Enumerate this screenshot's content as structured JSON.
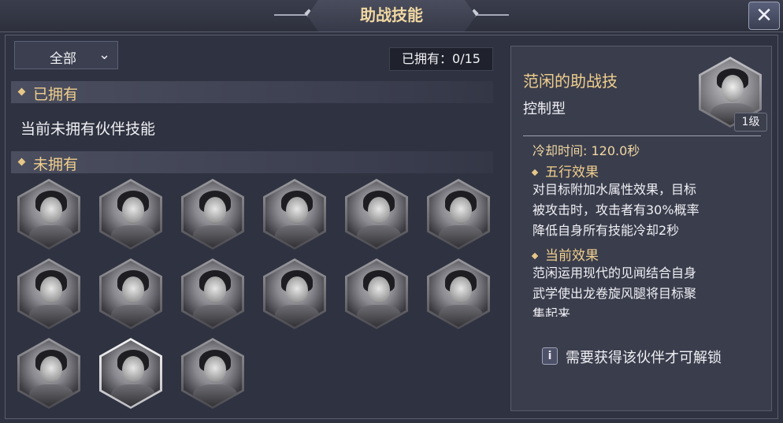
{
  "header": {
    "title": "助战技能",
    "close_icon": "close-x-icon"
  },
  "filter": {
    "selected": "全部",
    "chevron": "chevron-down-icon"
  },
  "owned_count": "已拥有：0/15",
  "sections": {
    "owned": {
      "label": "已拥有",
      "empty_text": "当前未拥有伙伴技能"
    },
    "not_owned": {
      "label": "未拥有"
    }
  },
  "partners": [
    {
      "icon": "hooded-elder-portrait",
      "selected": false
    },
    {
      "icon": "young-man-headband-portrait",
      "selected": false
    },
    {
      "icon": "long-hair-swordsman-portrait",
      "selected": false
    },
    {
      "icon": "white-haired-elder-portrait",
      "selected": false
    },
    {
      "icon": "blindfolded-man-portrait",
      "selected": false
    },
    {
      "icon": "young-man-topknot-portrait",
      "selected": false
    },
    {
      "icon": "long-hair-man-portrait",
      "selected": false
    },
    {
      "icon": "bearded-man-headband-portrait",
      "selected": false
    },
    {
      "icon": "masked-man-portrait",
      "selected": false
    },
    {
      "icon": "armored-man-portrait",
      "selected": false
    },
    {
      "icon": "youth-crown-portrait",
      "selected": false
    },
    {
      "icon": "young-woman-portrait",
      "selected": false
    },
    {
      "icon": "official-hat-man-portrait",
      "selected": false
    },
    {
      "icon": "fan-xian-portrait",
      "selected": true
    },
    {
      "icon": "lady-hairpin-portrait",
      "selected": false
    }
  ],
  "detail": {
    "skill_name": "范闲的助战技",
    "skill_type": "控制型",
    "level_badge": "1级",
    "cooldown": "冷却时间: 120.0秒",
    "five_elements_title": "五行效果",
    "five_elements_lines": [
      "对目标附加水属性效果，目标",
      "被攻击时，攻击者有30%概率",
      "降低自身所有技能冷却2秒"
    ],
    "current_effect_title": "当前效果",
    "current_effect_lines": [
      "范闲运用现代的见闻结合自身",
      "武学使出龙卷旋风腿将目标聚",
      "集起来"
    ],
    "lock_note": "需要获得该伙伴才可解锁",
    "lock_icon": "info-icon"
  }
}
